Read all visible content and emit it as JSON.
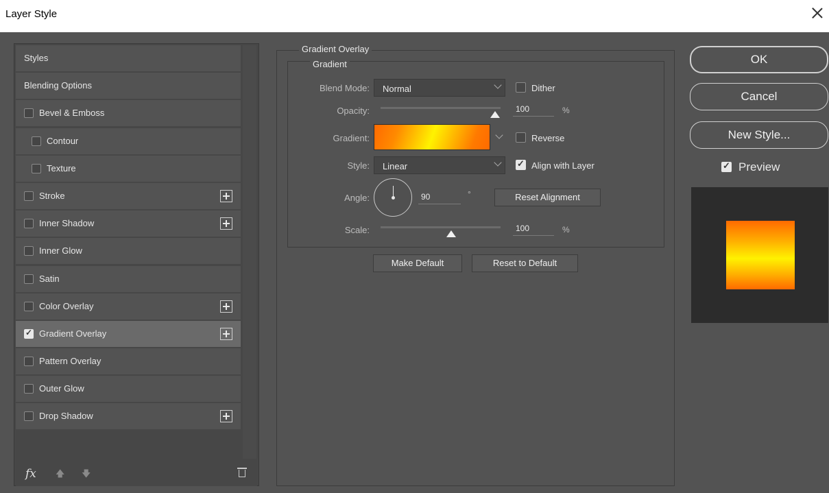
{
  "window": {
    "title": "Layer Style"
  },
  "styles_panel": {
    "items": [
      {
        "label": "Styles",
        "has_checkbox": false,
        "checked": false,
        "has_plus": false,
        "indent": 0,
        "selected": false
      },
      {
        "label": "Blending Options",
        "has_checkbox": false,
        "checked": false,
        "has_plus": false,
        "indent": 0,
        "selected": false
      },
      {
        "label": "Bevel & Emboss",
        "has_checkbox": true,
        "checked": false,
        "has_plus": false,
        "indent": 0,
        "selected": false
      },
      {
        "label": "Contour",
        "has_checkbox": true,
        "checked": false,
        "has_plus": false,
        "indent": 1,
        "selected": false
      },
      {
        "label": "Texture",
        "has_checkbox": true,
        "checked": false,
        "has_plus": false,
        "indent": 1,
        "selected": false
      },
      {
        "label": "Stroke",
        "has_checkbox": true,
        "checked": false,
        "has_plus": true,
        "indent": 0,
        "selected": false
      },
      {
        "label": "Inner Shadow",
        "has_checkbox": true,
        "checked": false,
        "has_plus": true,
        "indent": 0,
        "selected": false
      },
      {
        "label": "Inner Glow",
        "has_checkbox": true,
        "checked": false,
        "has_plus": false,
        "indent": 0,
        "selected": false
      },
      {
        "label": "Satin",
        "has_checkbox": true,
        "checked": false,
        "has_plus": false,
        "indent": 0,
        "selected": false
      },
      {
        "label": "Color Overlay",
        "has_checkbox": true,
        "checked": false,
        "has_plus": true,
        "indent": 0,
        "selected": false
      },
      {
        "label": "Gradient Overlay",
        "has_checkbox": true,
        "checked": true,
        "has_plus": true,
        "indent": 0,
        "selected": true
      },
      {
        "label": "Pattern Overlay",
        "has_checkbox": true,
        "checked": false,
        "has_plus": false,
        "indent": 0,
        "selected": false
      },
      {
        "label": "Outer Glow",
        "has_checkbox": true,
        "checked": false,
        "has_plus": false,
        "indent": 0,
        "selected": false
      },
      {
        "label": "Drop Shadow",
        "has_checkbox": true,
        "checked": false,
        "has_plus": true,
        "indent": 0,
        "selected": false
      }
    ],
    "footer": {
      "fx_label": "fx",
      "up_icon": "arrow-up-icon",
      "down_icon": "arrow-down-icon",
      "trash_icon": "trash-icon"
    }
  },
  "gradient_overlay": {
    "group_title": "Gradient Overlay",
    "sub_title": "Gradient",
    "blend_mode": {
      "label": "Blend Mode:",
      "value": "Normal"
    },
    "dither": {
      "label": "Dither",
      "checked": false
    },
    "opacity": {
      "label": "Opacity:",
      "value": "100",
      "unit": "%",
      "fraction": 1.0
    },
    "gradient": {
      "label": "Gradient:",
      "colors": [
        "#ff6a00",
        "#fff200",
        "#ff6a00"
      ]
    },
    "reverse": {
      "label": "Reverse",
      "checked": false
    },
    "style": {
      "label": "Style:",
      "value": "Linear"
    },
    "align_with_layer": {
      "label": "Align with Layer",
      "checked": true
    },
    "angle": {
      "label": "Angle:",
      "value": "90",
      "unit": "°"
    },
    "reset_alignment": "Reset Alignment",
    "scale": {
      "label": "Scale:",
      "value": "100",
      "unit": "%",
      "fraction": 0.6
    },
    "make_default": "Make Default",
    "reset_to_default": "Reset to Default"
  },
  "actions": {
    "ok": "OK",
    "cancel": "Cancel",
    "new_style": "New Style...",
    "preview": {
      "label": "Preview",
      "checked": true
    }
  }
}
